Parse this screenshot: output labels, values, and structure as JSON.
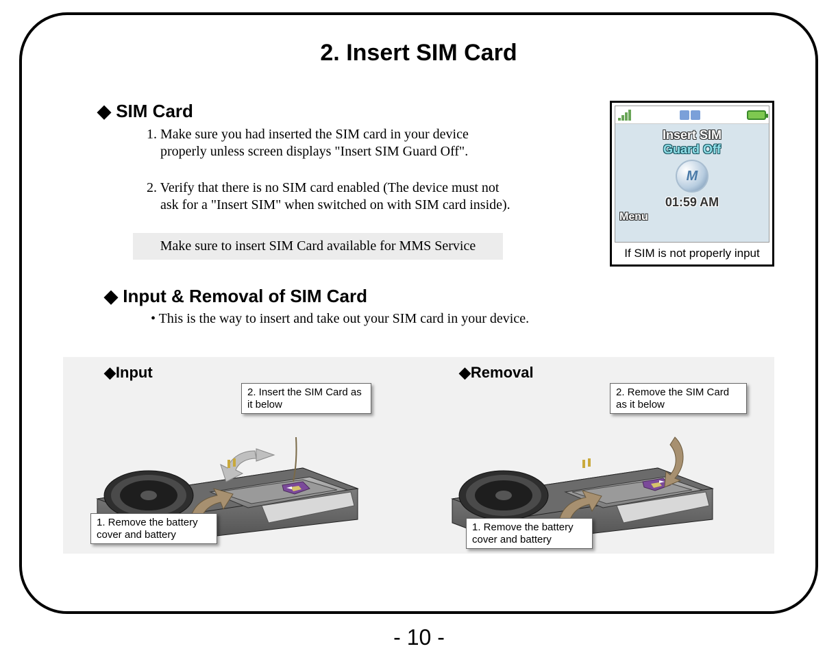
{
  "title": "2.  Insert SIM Card",
  "sim_card": {
    "heading": "◆ SIM Card",
    "step1": "1. Make sure you had inserted the SIM card in your device properly unless screen displays \"Insert SIM Guard Off\".",
    "step2": "2. Verify that there is no SIM card enabled (The device must not ask for a \"Insert SIM\" when switched on with SIM card inside).",
    "note": "Make sure to insert SIM Card available for MMS Service"
  },
  "phone": {
    "msg1": "Insert SIM",
    "msg2": "Guard Off",
    "time": "01:59 AM",
    "menu": "Menu",
    "caption": "If SIM is not properly input"
  },
  "io_section": {
    "heading": "◆ Input & Removal of SIM Card",
    "desc": "• This is the way to insert  and take out your SIM card in your device."
  },
  "input_panel": {
    "title": "◆Input",
    "callout_top": "2. Insert the SIM Card as it below",
    "callout_bottom": "1. Remove the battery cover and battery"
  },
  "removal_panel": {
    "title": "◆Removal",
    "callout_top": "2. Remove the SIM Card as it below",
    "callout_bottom": "1. Remove the battery cover and battery"
  },
  "page_number": "- 10 -"
}
